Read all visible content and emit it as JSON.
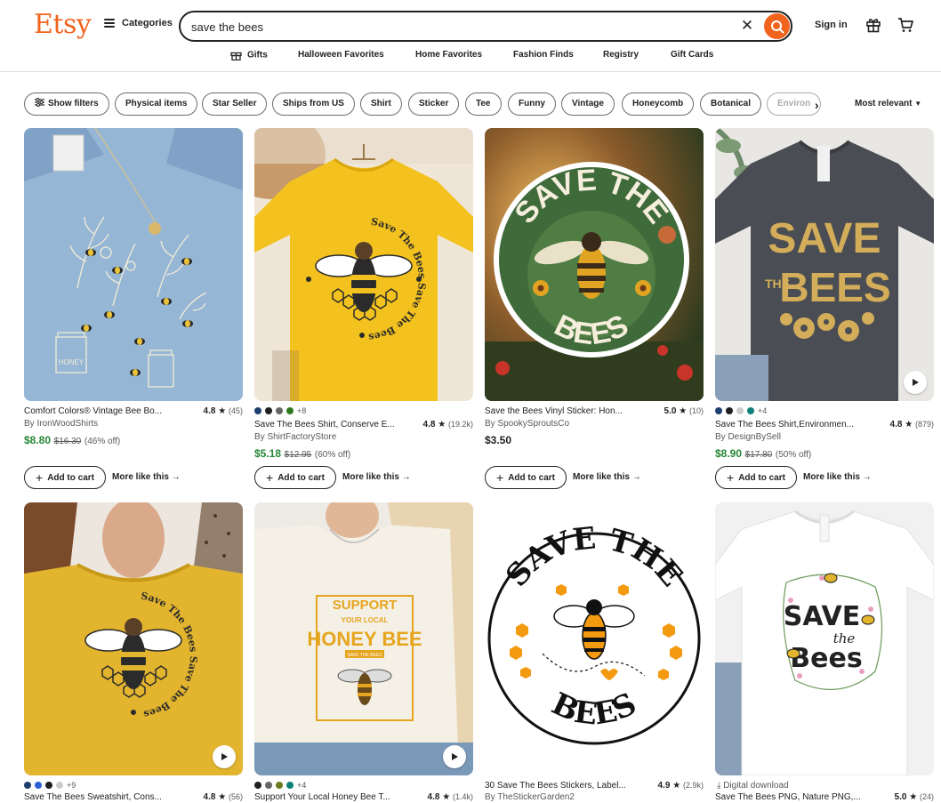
{
  "header": {
    "logo": "Etsy",
    "categories_label": "Categories",
    "search_value": "save the bees",
    "signin_label": "Sign in",
    "accent_color": "#f1641e"
  },
  "subnav": [
    "Gifts",
    "Halloween Favorites",
    "Home Favorites",
    "Fashion Finds",
    "Registry",
    "Gift Cards"
  ],
  "filters": {
    "chips": [
      "Show filters",
      "Physical items",
      "Star Seller",
      "Ships from US",
      "Shirt",
      "Sticker",
      "Tee",
      "Funny",
      "Vintage",
      "Honeycomb",
      "Botanical",
      "Environ"
    ],
    "sort_label": "Most relevant"
  },
  "buttons": {
    "add_to_cart": "Add to cart",
    "more_like_this": "More like this"
  },
  "products": [
    {
      "title": "Comfort Colors® Vintage Bee Bo...",
      "rating": "4.8",
      "reviews": "(45)",
      "shop": "By IronWoodShirts",
      "price": "$8.80",
      "original_price": "$16.30",
      "discount": "(46% off)",
      "swatches": [],
      "extra_colors": ""
    },
    {
      "title": "Save The Bees Shirt, Conserve E...",
      "rating": "4.8",
      "reviews": "(19.2k)",
      "shop": "By ShirtFactoryStore",
      "price": "$5.18",
      "original_price": "$12.95",
      "discount": "(60% off)",
      "swatches": [
        "#1d3f6e",
        "#1f1f1f",
        "#666666",
        "#2f7a1f"
      ],
      "extra_colors": "+8"
    },
    {
      "title": "Save the Bees Vinyl Sticker: Hon...",
      "rating": "5.0",
      "reviews": "(10)",
      "shop": "By SpookySproutsCo",
      "price": "$3.50",
      "original_price": "",
      "discount": "",
      "swatches": [],
      "extra_colors": ""
    },
    {
      "title": "Save The Bees Shirt,Environmen...",
      "rating": "4.8",
      "reviews": "(879)",
      "shop": "By DesignBySell",
      "price": "$8.90",
      "original_price": "$17.80",
      "discount": "(50% off)",
      "swatches": [
        "#1d3f6e",
        "#1f1f1f",
        "#cccccc",
        "#0f7f7a"
      ],
      "extra_colors": "+4"
    },
    {
      "title": "Save The Bees Sweatshirt, Cons...",
      "rating": "4.8",
      "reviews": "(56)",
      "swatches": [
        "#1d3f6e",
        "#2a62d6",
        "#1f1f1f",
        "#cccccc"
      ],
      "extra_colors": "+9"
    },
    {
      "title": "Support Your Local Honey Bee T...",
      "rating": "4.8",
      "reviews": "(1.4k)",
      "swatches": [
        "#1f1f1f",
        "#666666",
        "#6b7a1f",
        "#0f7f7a"
      ],
      "extra_colors": "+4"
    },
    {
      "title": "30 Save The Bees Stickers, Label...",
      "rating": "4.9",
      "reviews": "(2.9k)",
      "shop": "By TheStickerGarden2",
      "swatches": [],
      "extra_colors": ""
    },
    {
      "title": "Save The Bees PNG, Nature PNG,...",
      "rating": "5.0",
      "reviews": "(24)",
      "digital_label": "Digital download",
      "swatches": [],
      "extra_colors": ""
    }
  ],
  "image_text": {
    "p2_ring": "Save The Bees Save The Bees",
    "p3_top": "SAVE THE",
    "p3_bottom": "BEES",
    "p4_save": "SAVE",
    "p4_the": "THE",
    "p4_bees": "BEES",
    "p1_jar": "HONEY",
    "p6_support": "SUPPORT",
    "p6_your_local": "YOUR    LOCAL",
    "p6_honey_bee": "HONEY BEE",
    "p6_small": "SAVE THE BEES",
    "p7_top": "SAVE THE",
    "p7_bottom": "BEES",
    "p8_save": "SAVE",
    "p8_the": "the",
    "p8_bees": "Bees"
  }
}
